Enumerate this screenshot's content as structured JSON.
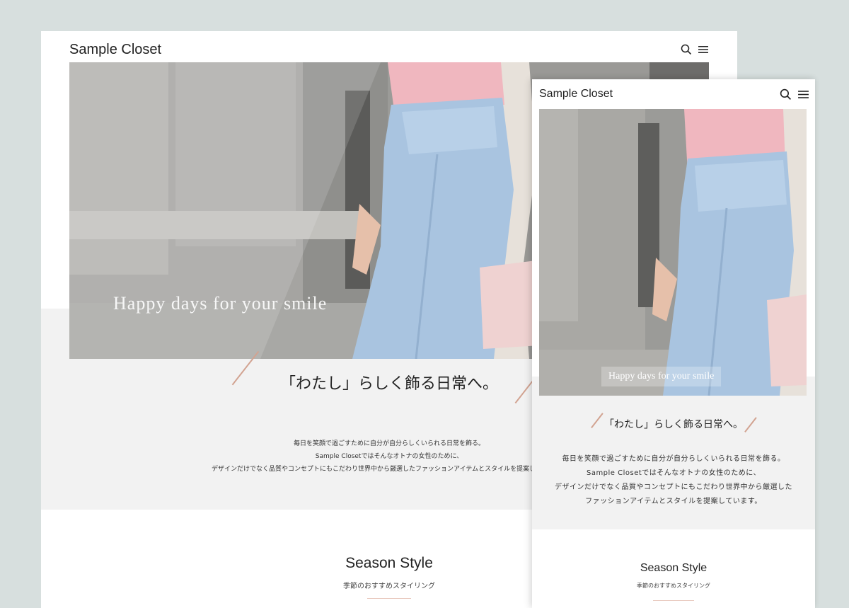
{
  "desktop": {
    "logo": "Sample Closet",
    "hero_tagline": "Happy days for your smile",
    "catchcopy": "「わたし」らしく飾る日常へ。",
    "description": [
      "毎日を笑顔で過ごすために自分が自分らしくいられる日常を飾る。",
      "Sample Closetではそんなオトナの女性のために、",
      "デザインだけでなく品質やコンセプトにもこだわり世界中から厳選したファッションアイテムとスタイルを提案しています。"
    ],
    "section_title": "Season Style",
    "section_subtitle": "季節のおすすめスタイリング"
  },
  "mobile": {
    "logo": "Sample Closet",
    "hero_tagline": "Happy days for your smile",
    "catchcopy": "「わたし」らしく飾る日常へ。",
    "description": [
      "毎日を笑顔で過ごすために自分が自分らしくいられる日常を飾る。",
      "Sample Closetではそんなオトナの女性のために、",
      "デザインだけでなく品質やコンセプトにもこだわり世界中から厳選した",
      "ファッションアイテムとスタイルを提案しています。"
    ],
    "section_title": "Season Style",
    "section_subtitle": "季節のおすすめスタイリング"
  },
  "icons": {
    "search": "search-icon",
    "menu": "hamburger-menu-icon"
  },
  "colors": {
    "background": "#d7dfde",
    "band": "#f2f2f2",
    "accent": "#d2a391",
    "denim": "#a9c4e0",
    "shirt": "#f0b7bf"
  }
}
